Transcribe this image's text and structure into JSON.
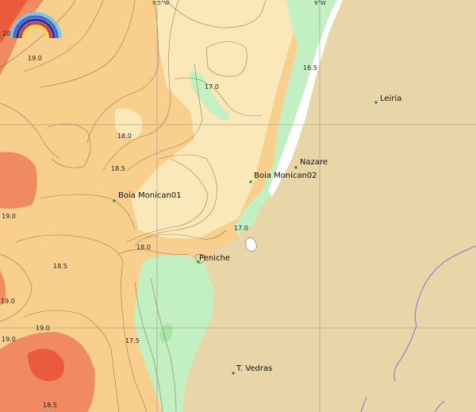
{
  "map": {
    "locations": [
      {
        "name": "Leiria"
      },
      {
        "name": "Nazare"
      },
      {
        "name": "Boia Monican02"
      },
      {
        "name": "Boia Monican01"
      },
      {
        "name": "Peniche"
      },
      {
        "name": "T. Vedras"
      }
    ],
    "contour_labels": [
      "20",
      "19.0",
      "17.0",
      "16.5",
      "18.0",
      "18.5",
      "19.0",
      "17.0",
      "18.0",
      "18.5",
      "19.0",
      "19.0",
      "17.5",
      "19.0",
      "18.5"
    ],
    "grid_labels": [
      "9.5°W",
      "9°W"
    ],
    "colors": {
      "land": "#e9d6a8",
      "sea_cool": "#c2f0c2",
      "sea_mid": "#fbe8b8",
      "sea_warm": "#f9cf8e",
      "sea_hot": "#f08a63",
      "sea_hottest": "#ea5a3c",
      "river": "#7777cc",
      "point": "#129612"
    },
    "logo_icon": "rainbow-logo-icon"
  }
}
